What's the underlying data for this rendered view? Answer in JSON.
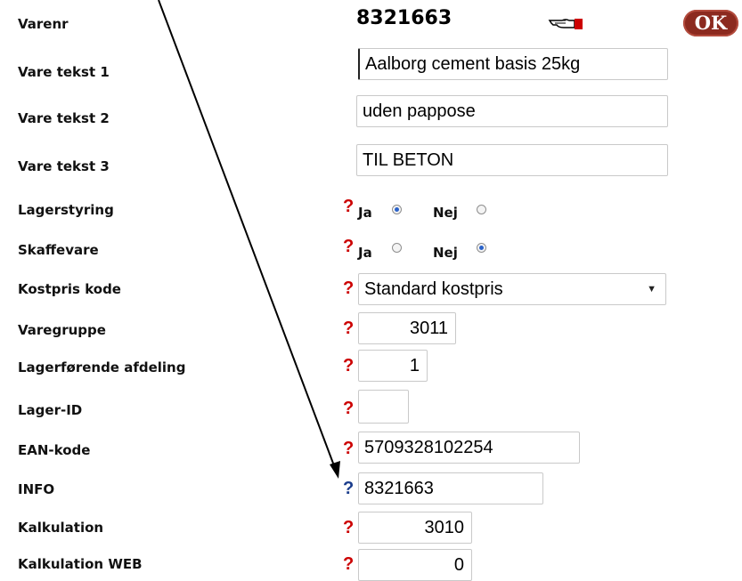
{
  "header": {
    "item_label": "Varenr",
    "item_number": "8321663",
    "ok_label": "OK",
    "hand_icon": "pointing-hand-icon"
  },
  "fields": {
    "text1": {
      "label": "Vare tekst 1",
      "value": "Aalborg cement basis     25kg"
    },
    "text2": {
      "label": "Vare tekst 2",
      "value": "uden pappose"
    },
    "text3": {
      "label": "Vare tekst 3",
      "value": "TIL BETON"
    },
    "stock_control": {
      "label": "Lagerstyring",
      "help": "?",
      "yes": "Ja",
      "no": "Nej",
      "selected": "yes"
    },
    "stock_item": {
      "label": "Skaffevare",
      "help": "?",
      "yes": "Ja",
      "no": "Nej",
      "selected": "no"
    },
    "cost_code": {
      "label": "Kostpris kode",
      "help": "?",
      "value": "Standard kostpris"
    },
    "item_group": {
      "label": "Varegruppe",
      "help": "?",
      "value": "3011"
    },
    "stock_dept": {
      "label": "Lagerførende afdeling",
      "help": "?",
      "value": "1"
    },
    "stock_id": {
      "label": "Lager-ID",
      "help": "?",
      "value": ""
    },
    "ean": {
      "label": "EAN-kode",
      "help": "?",
      "value": "5709328102254"
    },
    "info": {
      "label": "INFO",
      "help": "?",
      "value": "8321663"
    },
    "calc": {
      "label": "Kalkulation",
      "help": "?",
      "value": "3010"
    },
    "calc_web": {
      "label": "Kalkulation WEB",
      "help": "?",
      "value": "0"
    }
  },
  "colors": {
    "help_red": "#cc0000",
    "help_blue": "#1a3c8c",
    "ok_button": "#8c2a1f",
    "radio_checked": "#2a62c9"
  }
}
